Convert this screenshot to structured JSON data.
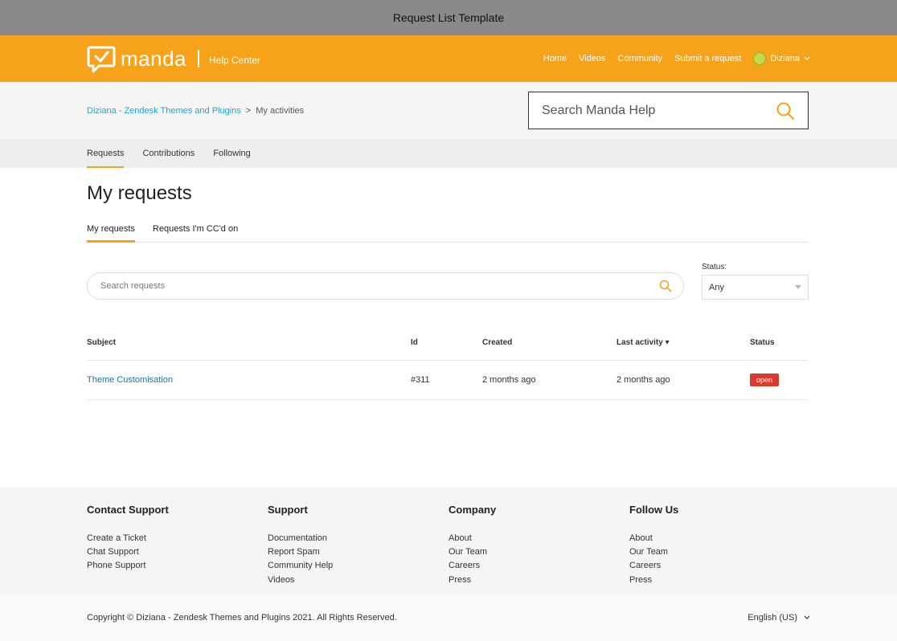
{
  "window": {
    "title": "Request List Template"
  },
  "header": {
    "brand_name": "manda",
    "brand_sub": "Help Center",
    "nav": [
      "Home",
      "Videos",
      "Community",
      "Submit a request"
    ],
    "user_name": "Diziana",
    "accent": "#f7a21b"
  },
  "breadcrumb": {
    "root": "Diziana - Zendesk Themes and Plugins",
    "separator": ">",
    "current": "My activities"
  },
  "search": {
    "placeholder": "Search Manda Help"
  },
  "tabs": [
    "Requests",
    "Contributions",
    "Following"
  ],
  "page": {
    "title": "My requests",
    "subtabs": [
      "My requests",
      "Requests I'm CC'd on"
    ],
    "search_placeholder": "Search requests",
    "status_label": "Status:",
    "status_value": "Any"
  },
  "table": {
    "headers": [
      "Subject",
      "Id",
      "Created",
      "Last activity ▾",
      "Status"
    ],
    "rows": [
      {
        "subject": "Theme Customisation",
        "id": "#311",
        "created": "2 months ago",
        "last_activity": "2 months ago",
        "status": "open"
      }
    ]
  },
  "footer": {
    "columns": [
      {
        "title": "Contact Support",
        "items": [
          "Create a Ticket",
          "Chat Support",
          "Phone Support"
        ]
      },
      {
        "title": "Support",
        "items": [
          "Documentation",
          "Report Spam",
          "Community Help",
          "Videos"
        ]
      },
      {
        "title": "Company",
        "items": [
          "About",
          "Our Team",
          "Careers",
          "Press"
        ]
      },
      {
        "title": "Follow Us",
        "items": [
          "About",
          "Our Team",
          "Careers",
          "Press"
        ]
      }
    ],
    "copyright": "Copyright © Diziana - Zendesk Themes and Plugins 2021. All Rights Reserved.",
    "language": "English (US)"
  }
}
